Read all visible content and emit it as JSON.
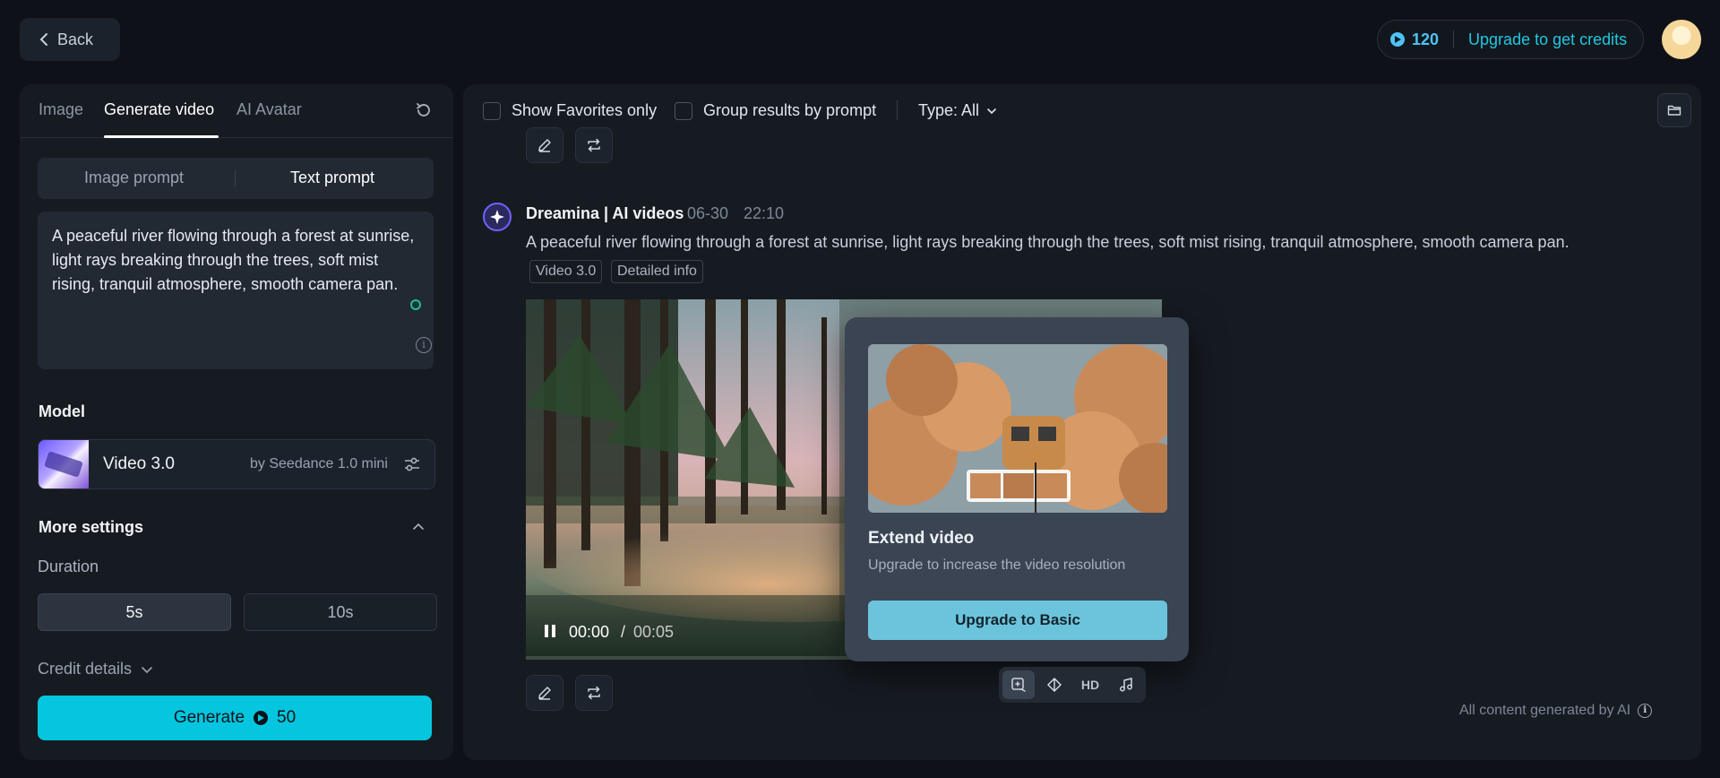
{
  "top": {
    "back_label": "Back",
    "credits": "120",
    "upgrade_label": "Upgrade to get credits"
  },
  "left": {
    "tabs": [
      {
        "label": "Image"
      },
      {
        "label": "Generate video"
      },
      {
        "label": "AI Avatar"
      }
    ],
    "active_tab": "Generate video",
    "prompt_modes": [
      "Image prompt",
      "Text prompt"
    ],
    "active_prompt_mode": "Text prompt",
    "prompt_text": "A peaceful river flowing through a forest at sunrise, light rays breaking through the trees, soft mist rising, tranquil atmosphere, smooth camera pan.",
    "model_label": "Model",
    "model_name": "Video 3.0",
    "model_by": "by Seedance 1.0 mini",
    "more_settings_label": "More settings",
    "duration_label": "Duration",
    "durations": [
      "5s",
      "10s"
    ],
    "selected_duration": "5s",
    "credit_details_label": "Credit details",
    "generate_label": "Generate",
    "generate_cost": "50"
  },
  "right": {
    "filters": {
      "favorites_label": "Show Favorites only",
      "group_label": "Group results by prompt",
      "type_label": "Type: All"
    },
    "result": {
      "agent_name": "Dreamina | AI videos",
      "date": "06-30",
      "time": "22:10",
      "prompt": "A peaceful river flowing through a forest at sunrise, light rays breaking through the trees, soft mist rising, tranquil atmosphere, smooth camera pan.",
      "tags": [
        "Video 3.0",
        "Detailed info"
      ],
      "video_current": "00:00",
      "video_separator": "/",
      "video_total": "00:05",
      "progress": 0.0
    },
    "popover": {
      "title": "Extend video",
      "subtitle": "Upgrade to increase the video resolution",
      "button_label": "Upgrade to Basic"
    },
    "video_tools": {
      "hd_label": "HD"
    },
    "footer_note": "All content generated by AI"
  },
  "colors": {
    "accent": "#06c5df",
    "background": "#0e1218",
    "panel": "#161b22"
  },
  "icons": [
    "chevron-left-icon",
    "credit-coin-icon",
    "reset-icon",
    "info-icon",
    "sliders-icon",
    "chevron-up-icon",
    "chevron-down-icon",
    "folder-icon",
    "edit-icon",
    "regenerate-icon",
    "pause-icon",
    "extend-icon",
    "interpolate-icon",
    "hd-icon",
    "music-icon"
  ]
}
